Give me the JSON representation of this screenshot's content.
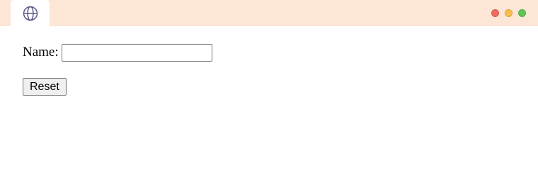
{
  "browser": {
    "tab_icon": "globe-icon",
    "controls": {
      "close_color": "#ec6a5e",
      "minimize_color": "#f4bf4f",
      "maximize_color": "#61c554"
    },
    "tabbar_color": "#fde6d6"
  },
  "form": {
    "name_label": "Name:",
    "name_value": "",
    "name_placeholder": "",
    "reset_label": "Reset"
  }
}
